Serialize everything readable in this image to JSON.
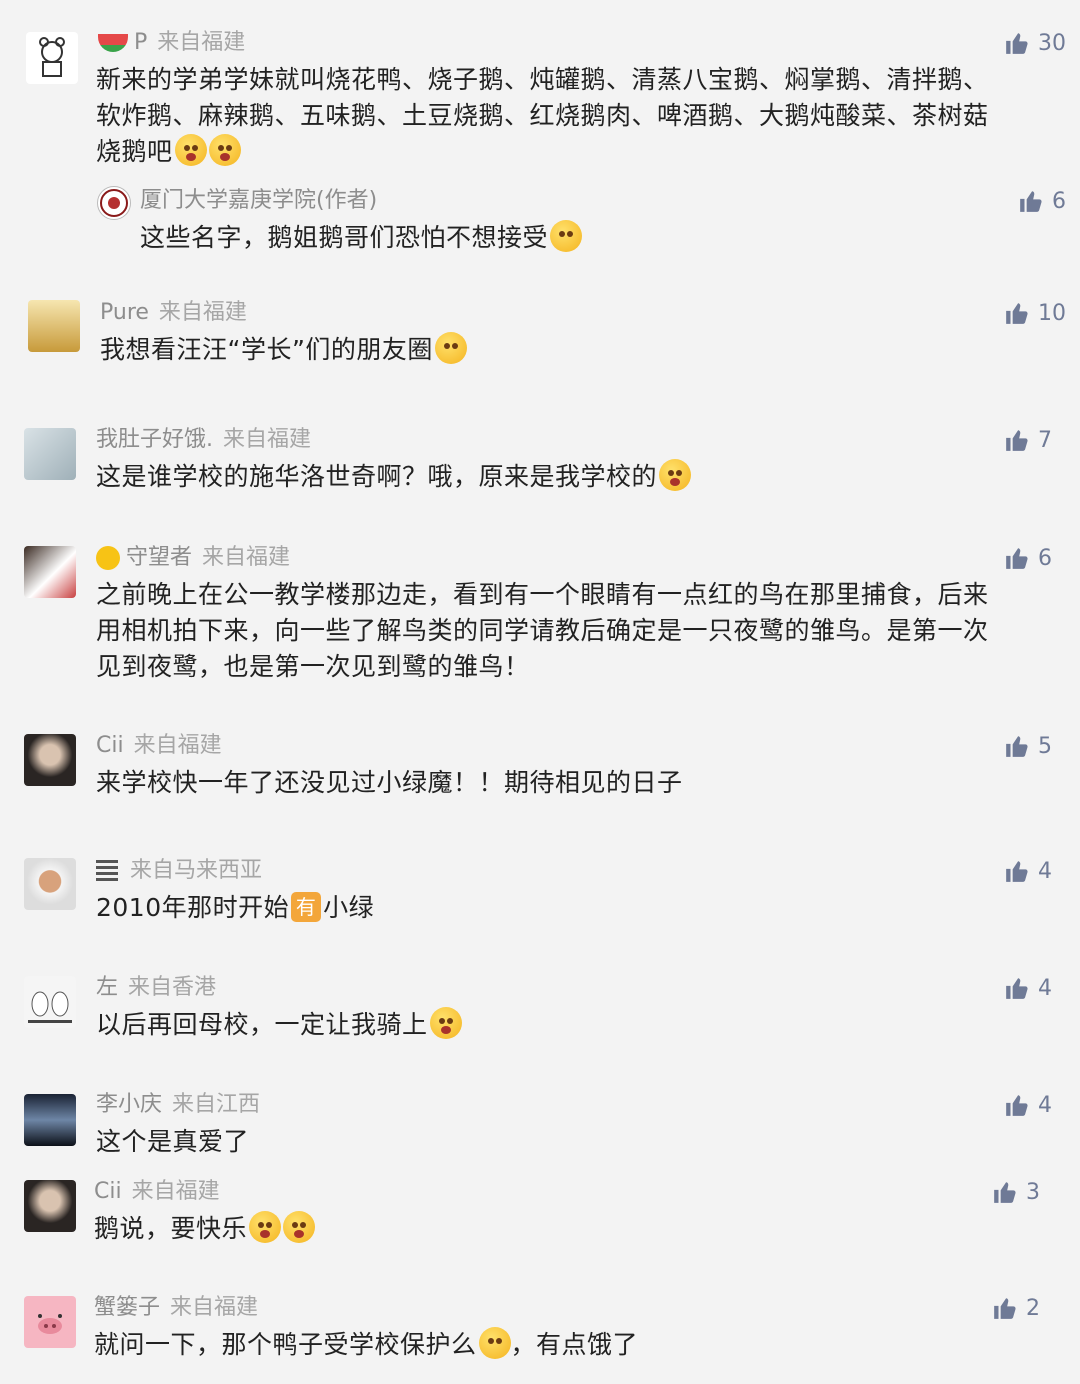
{
  "comments": [
    {
      "name": "P",
      "location": "来自福建",
      "likes": "30",
      "text_lines": [
        "新来的学弟学妹就叫烧花鸭、烧子鹅、炖罐鹅、清蒸八宝鹅、焖掌鹅、清拌鹅、",
        "软炸鹅、麻辣鹅、五味鹅、土豆烧鹅、红烧鹅肉、啤酒鹅、大鹅炖酸菜、茶树菇",
        "烧鹅吧"
      ],
      "reply": {
        "name": "厦门大学嘉庚学院(作者)",
        "likes": "6",
        "text": "这些名字，鹅姐鹅哥们恐怕不想接受"
      }
    },
    {
      "name": "Pure",
      "location": "来自福建",
      "likes": "10",
      "text_lines": [
        "我想看汪汪“学长”们的朋友圈"
      ]
    },
    {
      "name": "我肚子好饿.",
      "location": "来自福建",
      "likes": "7",
      "text_lines": [
        "这是谁学校的施华洛世奇啊？哦，原来是我学校的"
      ]
    },
    {
      "name": "守望者",
      "location": "来自福建",
      "likes": "6",
      "text_lines": [
        "之前晚上在公一教学楼那边走，看到有一个眼睛有一点红的鸟在那里捕食，后来",
        "用相机拍下来，向一些了解鸟类的同学请教后确定是一只夜鹭的雏鸟。是第一次",
        "见到夜鹭，也是第一次见到鹭的雏鸟！"
      ]
    },
    {
      "name": "Cii",
      "location": "来自福建",
      "likes": "5",
      "text_lines": [
        "来学校快一年了还没见过小绿魔！！期待相见的日子"
      ]
    },
    {
      "name": "",
      "location": "来自马来西亚",
      "likes": "4",
      "text_before": "2010年那时开始",
      "badge": "有",
      "text_after": "小绿"
    },
    {
      "name": "左",
      "location": "来自香港",
      "likes": "4",
      "text_lines": [
        "以后再回母校，一定让我骑上"
      ]
    },
    {
      "name": "李小庆",
      "location": "来自江西",
      "likes": "4",
      "text_lines": [
        "这个是真爱了"
      ]
    },
    {
      "name": "Cii",
      "location": "来自福建",
      "likes": "3",
      "text_lines": [
        "鹅说，要快乐"
      ]
    },
    {
      "name": "蟹篓子",
      "location": "来自福建",
      "likes": "2",
      "text_before": "就问一下，那个鸭子受学校保护么",
      "text_after": "，有点饿了"
    }
  ],
  "colors": {
    "background": "#f3f3f3",
    "like": "#6f7a96",
    "meta": "#9a9a9a",
    "text": "#222222"
  }
}
